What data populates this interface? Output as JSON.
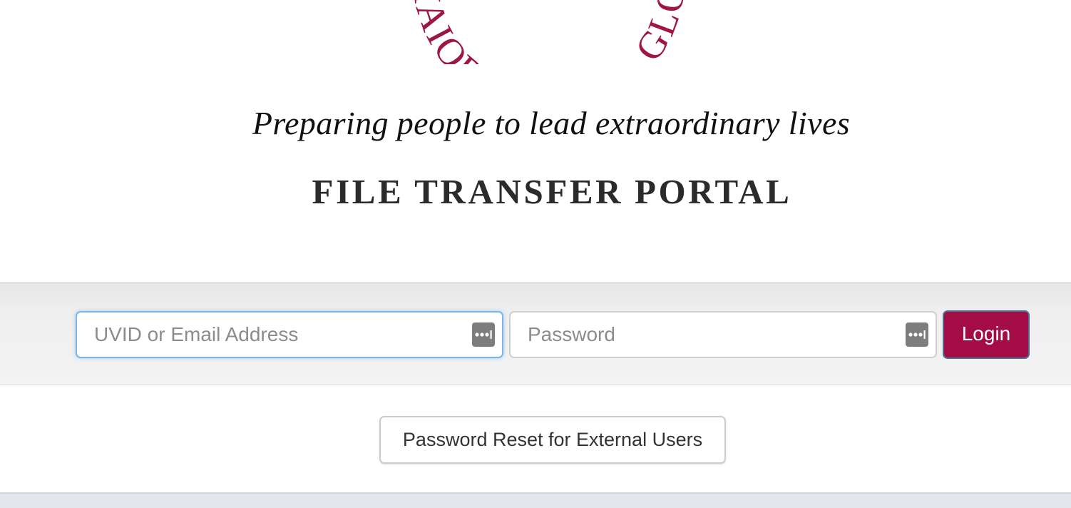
{
  "header": {
    "seal_motto": "AD ∙ MAIOREM ∙ DEI ∙ GLORIAM",
    "tagline": "Preparing people to lead extraordinary lives",
    "portal_title": "FILE TRANSFER PORTAL"
  },
  "login": {
    "username_placeholder": "UVID or Email Address",
    "username_value": "",
    "password_placeholder": "Password",
    "password_value": "",
    "autofill_icon": "password-manager-key-icon",
    "login_label": "Login"
  },
  "reset": {
    "label": "Password Reset for External Users"
  },
  "colors": {
    "brand": "#a30c45",
    "focus_border": "#79b7ea",
    "band_background": "#efefef",
    "text_dark": "#333333",
    "placeholder": "#8c8c8c"
  }
}
